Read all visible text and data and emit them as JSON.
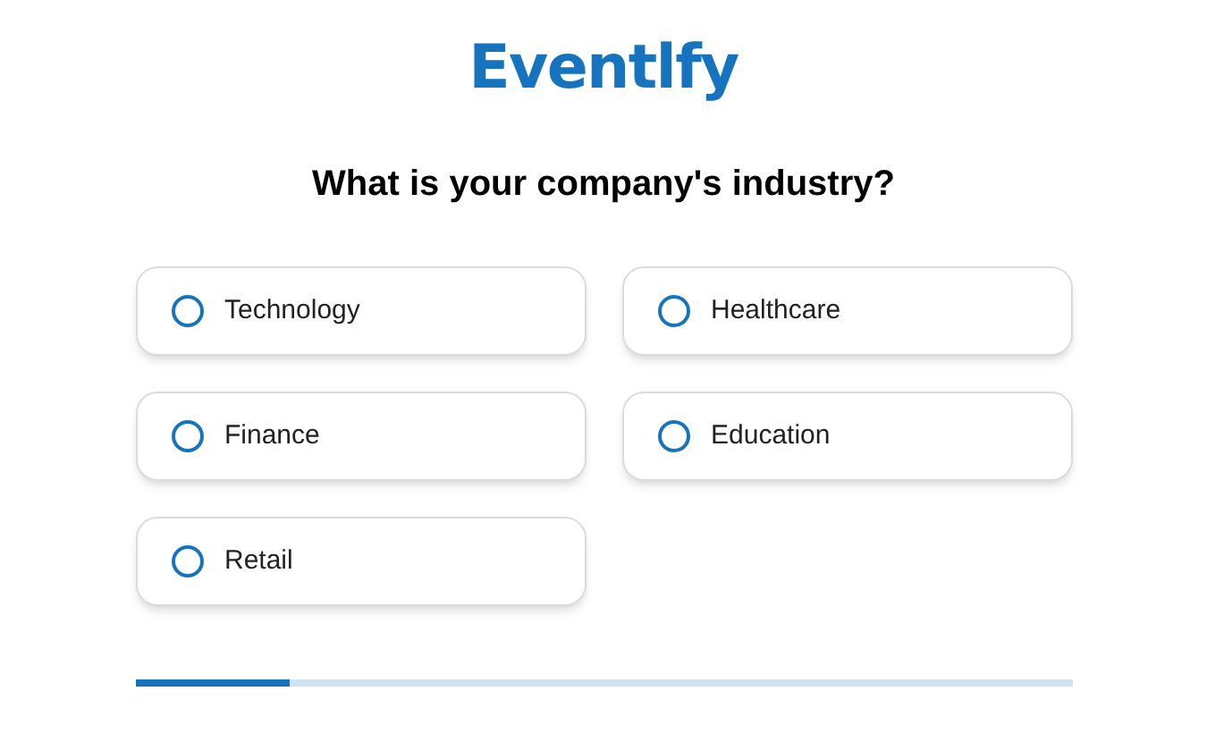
{
  "logo": "Eventlfy",
  "question": "What is your company's industry?",
  "options": [
    {
      "label": "Technology",
      "selected": false
    },
    {
      "label": "Healthcare",
      "selected": false
    },
    {
      "label": "Finance",
      "selected": false
    },
    {
      "label": "Education",
      "selected": false
    },
    {
      "label": "Retail",
      "selected": false
    }
  ],
  "progress": {
    "level": 0.166
  }
}
